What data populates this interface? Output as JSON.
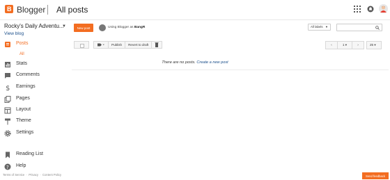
{
  "app": {
    "brand": "Blogger",
    "page_title": "All posts",
    "logo_letter": "B",
    "accent_color": "#f36d21"
  },
  "sidebar": {
    "blog_name": "Rocky's Daily Adventu...",
    "view_blog": "View blog",
    "items": [
      {
        "label": "Posts",
        "icon": "posts-icon",
        "active": true
      },
      {
        "label": "Stats",
        "icon": "stats-icon"
      },
      {
        "label": "Comments",
        "icon": "comments-icon"
      },
      {
        "label": "Earnings",
        "icon": "dollar-icon"
      },
      {
        "label": "Pages",
        "icon": "pages-icon"
      },
      {
        "label": "Layout",
        "icon": "layout-icon"
      },
      {
        "label": "Theme",
        "icon": "paint-roller-icon"
      },
      {
        "label": "Settings",
        "icon": "gear-icon"
      }
    ],
    "sub_all": "All",
    "bottom_items": [
      {
        "label": "Reading List",
        "icon": "bookmark-icon"
      },
      {
        "label": "Help",
        "icon": "help-icon"
      }
    ],
    "footer": {
      "terms": "Terms of Service",
      "privacy": "Privacy",
      "content_policy": "Content Policy"
    }
  },
  "main": {
    "new_post": "New post",
    "using_prefix": "Using Blogger as",
    "user_name": "BangR",
    "labels_select": "All labels",
    "search_placeholder": "",
    "toolbar": {
      "publish": "Publish",
      "revert": "Revert to draft"
    },
    "pager": {
      "page": "1",
      "per_page": "25"
    },
    "empty_text": "There are no posts.",
    "create_link": "Create a new post"
  },
  "feedback": "Send feedback"
}
